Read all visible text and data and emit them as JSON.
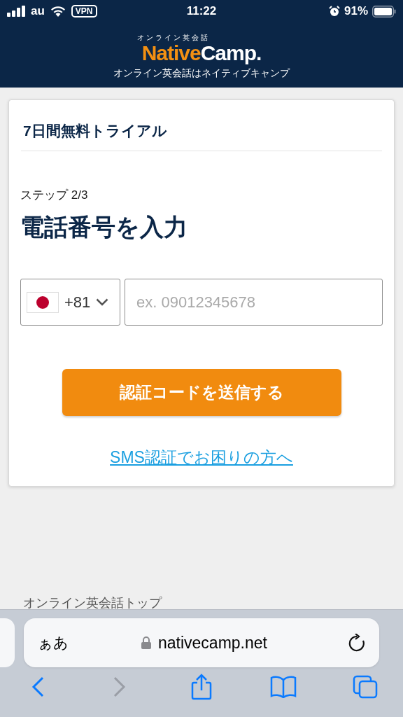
{
  "status_bar": {
    "carrier": "au",
    "vpn": "VPN",
    "time": "11:22",
    "battery": "91%"
  },
  "header": {
    "logo_kicker": "オンライン英会話",
    "logo_native": "Native",
    "logo_camp": "Camp.",
    "tagline": "オンライン英会話はネイティブキャンプ"
  },
  "card": {
    "title": "7日間無料トライアル",
    "step": "ステップ 2/3",
    "heading": "電話番号を入力",
    "phone": {
      "country_code": "+81",
      "placeholder": "ex. 09012345678"
    },
    "submit": "認証コードを送信する",
    "help_link": "SMS認証でお困りの方へ"
  },
  "footer": {
    "link": "オンライン英会話トップ"
  },
  "browser": {
    "text_size": "ぁあ",
    "url": "nativecamp.net",
    "toolbar": [
      {
        "kind": "back",
        "disabled": false
      },
      {
        "kind": "forward",
        "disabled": true
      },
      {
        "kind": "share",
        "disabled": false
      },
      {
        "kind": "bookmarks",
        "disabled": false
      },
      {
        "kind": "tabs",
        "disabled": false
      }
    ]
  }
}
